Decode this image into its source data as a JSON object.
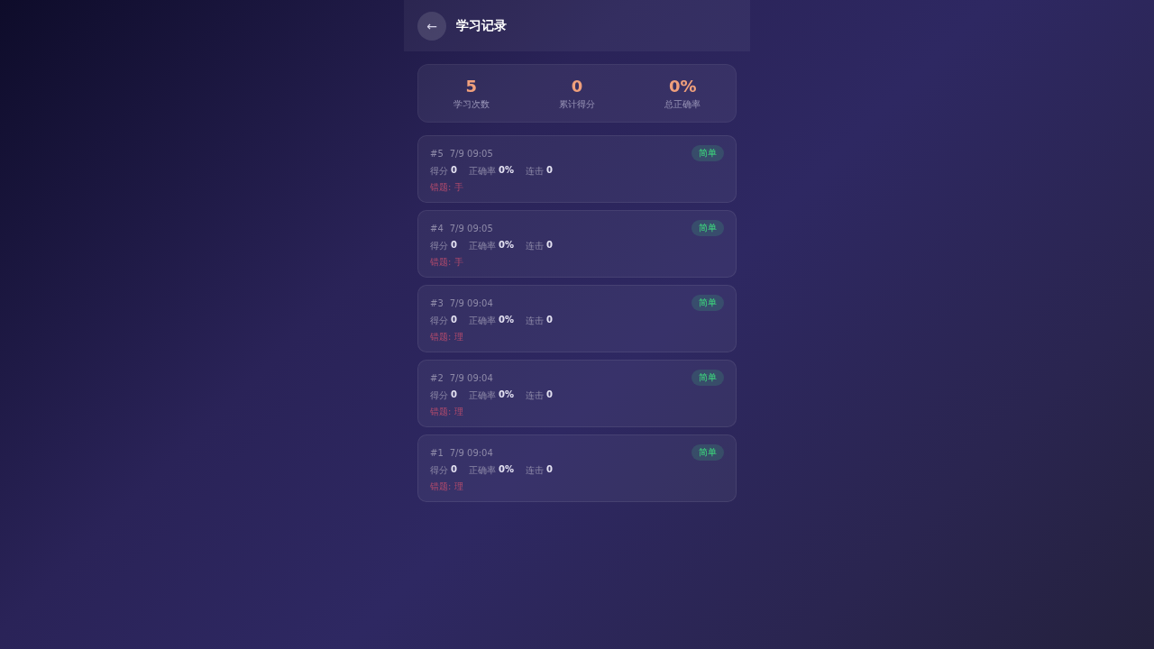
{
  "header": {
    "back_icon": "←",
    "title": "学习记录"
  },
  "summary": [
    {
      "value": "5",
      "label": "学习次数"
    },
    {
      "value": "0",
      "label": "累计得分"
    },
    {
      "value": "0%",
      "label": "总正确率"
    }
  ],
  "records": [
    {
      "index": "#5",
      "time": "7/9 09:05",
      "difficulty": "简单",
      "stats": [
        {
          "label": "得分",
          "value": "0"
        },
        {
          "label": "正确率",
          "value": "0%"
        },
        {
          "label": "连击",
          "value": "0"
        }
      ],
      "mistakes": "错题: 手"
    },
    {
      "index": "#4",
      "time": "7/9 09:05",
      "difficulty": "简单",
      "stats": [
        {
          "label": "得分",
          "value": "0"
        },
        {
          "label": "正确率",
          "value": "0%"
        },
        {
          "label": "连击",
          "value": "0"
        }
      ],
      "mistakes": "错题: 手"
    },
    {
      "index": "#3",
      "time": "7/9 09:04",
      "difficulty": "简单",
      "stats": [
        {
          "label": "得分",
          "value": "0"
        },
        {
          "label": "正确率",
          "value": "0%"
        },
        {
          "label": "连击",
          "value": "0"
        }
      ],
      "mistakes": "错题: 理"
    },
    {
      "index": "#2",
      "time": "7/9 09:04",
      "difficulty": "简单",
      "stats": [
        {
          "label": "得分",
          "value": "0"
        },
        {
          "label": "正确率",
          "value": "0%"
        },
        {
          "label": "连击",
          "value": "0"
        }
      ],
      "mistakes": "错题: 理"
    },
    {
      "index": "#1",
      "time": "7/9 09:04",
      "difficulty": "简单",
      "stats": [
        {
          "label": "得分",
          "value": "0"
        },
        {
          "label": "正确率",
          "value": "0%"
        },
        {
          "label": "连击",
          "value": "0"
        }
      ],
      "mistakes": "错题: 理"
    }
  ]
}
